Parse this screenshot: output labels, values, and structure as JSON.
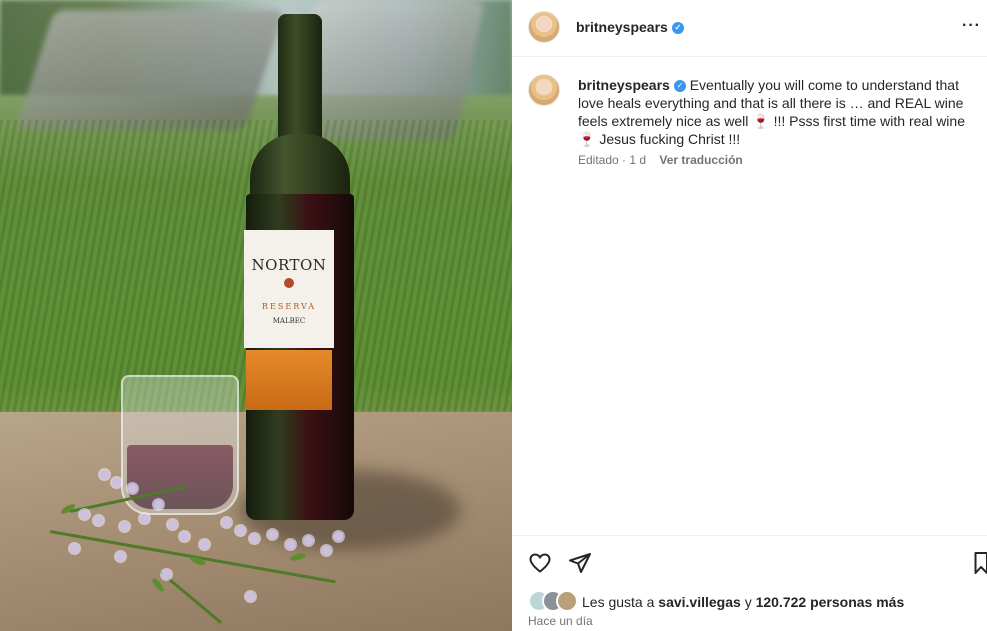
{
  "post": {
    "username": "britneyspears",
    "more_icon": "more-horizontal-icon",
    "caption": "Eventually you will come to understand that love heals everything and that is all there is … and REAL wine feels extremely nice as well 🍷 !!! Psss first time with real wine 🍷 Jesus fucking Christ !!!",
    "meta": {
      "edited": "Editado · 1 d",
      "translate": "Ver traducción"
    },
    "likes": {
      "prefix": "Les gusta a",
      "user": "savi.villegas",
      "conj": "y",
      "count": "120.722 personas más"
    },
    "time": "Hace un día"
  },
  "photo": {
    "label_brand": "NORTON",
    "label_line": "RESERVA",
    "label_variety": "MALBEC"
  },
  "icons": {
    "verified": "verified-badge-icon",
    "like": "heart-icon",
    "share": "send-icon",
    "save": "bookmark-icon"
  },
  "colors": {
    "verified": "#3897f0",
    "text": "#262626",
    "muted": "#737373"
  }
}
